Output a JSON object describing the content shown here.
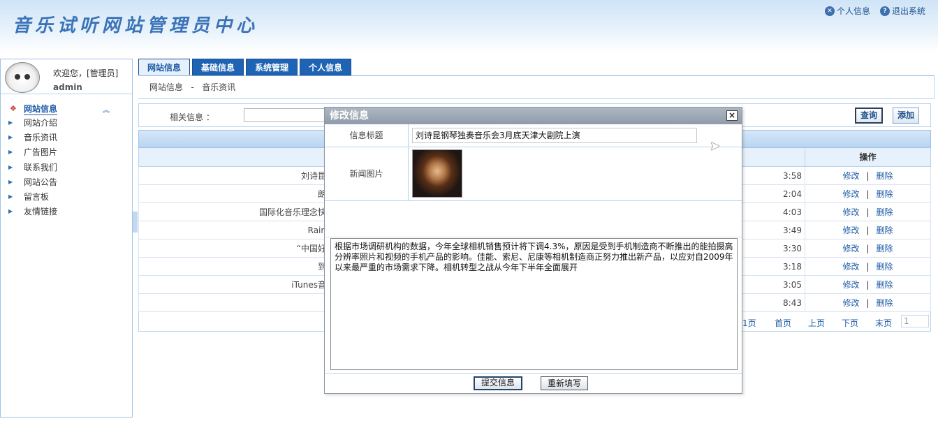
{
  "header": {
    "site_title": "音乐试听网站管理员中心",
    "personal_info": "个人信息",
    "logout": "退出系统"
  },
  "user": {
    "welcome": "欢迎您，[管理员]",
    "name": "admin"
  },
  "menu": {
    "head": "网站信息",
    "items": [
      "网站介绍",
      "音乐资讯",
      "广告图片",
      "联系我们",
      "网站公告",
      "留言板",
      "友情链接"
    ]
  },
  "tabs": [
    "网站信息",
    "基础信息",
    "系统管理",
    "个人信息"
  ],
  "breadcrumb": {
    "section": "网站信息",
    "separator": "-",
    "page": "音乐资讯"
  },
  "search": {
    "label": "相关信息 ：",
    "query_button": "查询",
    "add_button": "添加"
  },
  "table": {
    "action_header": "操作",
    "rows": [
      {
        "title": "刘诗昆",
        "time": "3:58"
      },
      {
        "title": "朗",
        "time": "2:04"
      },
      {
        "title": "国际化音乐理念快",
        "time": "4:03"
      },
      {
        "title": "Rain",
        "time": "3:49"
      },
      {
        "title": "“中国好",
        "time": "3:30"
      },
      {
        "title": "到",
        "time": "3:18"
      },
      {
        "title": "iTunes音",
        "time": "3:05"
      },
      {
        "title": "",
        "time": "8:43"
      }
    ],
    "edit_label": "修改",
    "delete_label": "删除",
    "separator": "|"
  },
  "pager": {
    "info": "/1页",
    "first": "首页",
    "prev": "上页",
    "next": "下页",
    "last": "末页",
    "page_value": "1"
  },
  "modal": {
    "title": "修改信息",
    "close": "×",
    "title_label": "信息标题",
    "title_value": "刘诗昆钢琴独奏音乐会3月底天津大剧院上演",
    "image_label": "新闻图片",
    "content": "根据市场调研机构的数据，今年全球相机销售预计将下调4.3%，原因是受到手机制造商不断推出的能拍摄高分辨率照片和视频的手机产品的影响。佳能、索尼、尼康等相机制造商正努力推出新产品，以应对自2009年以来最严重的市场需求下降。相机转型之战从今年下半年全面展开",
    "submit": "提交信息",
    "reset": "重新填写"
  }
}
